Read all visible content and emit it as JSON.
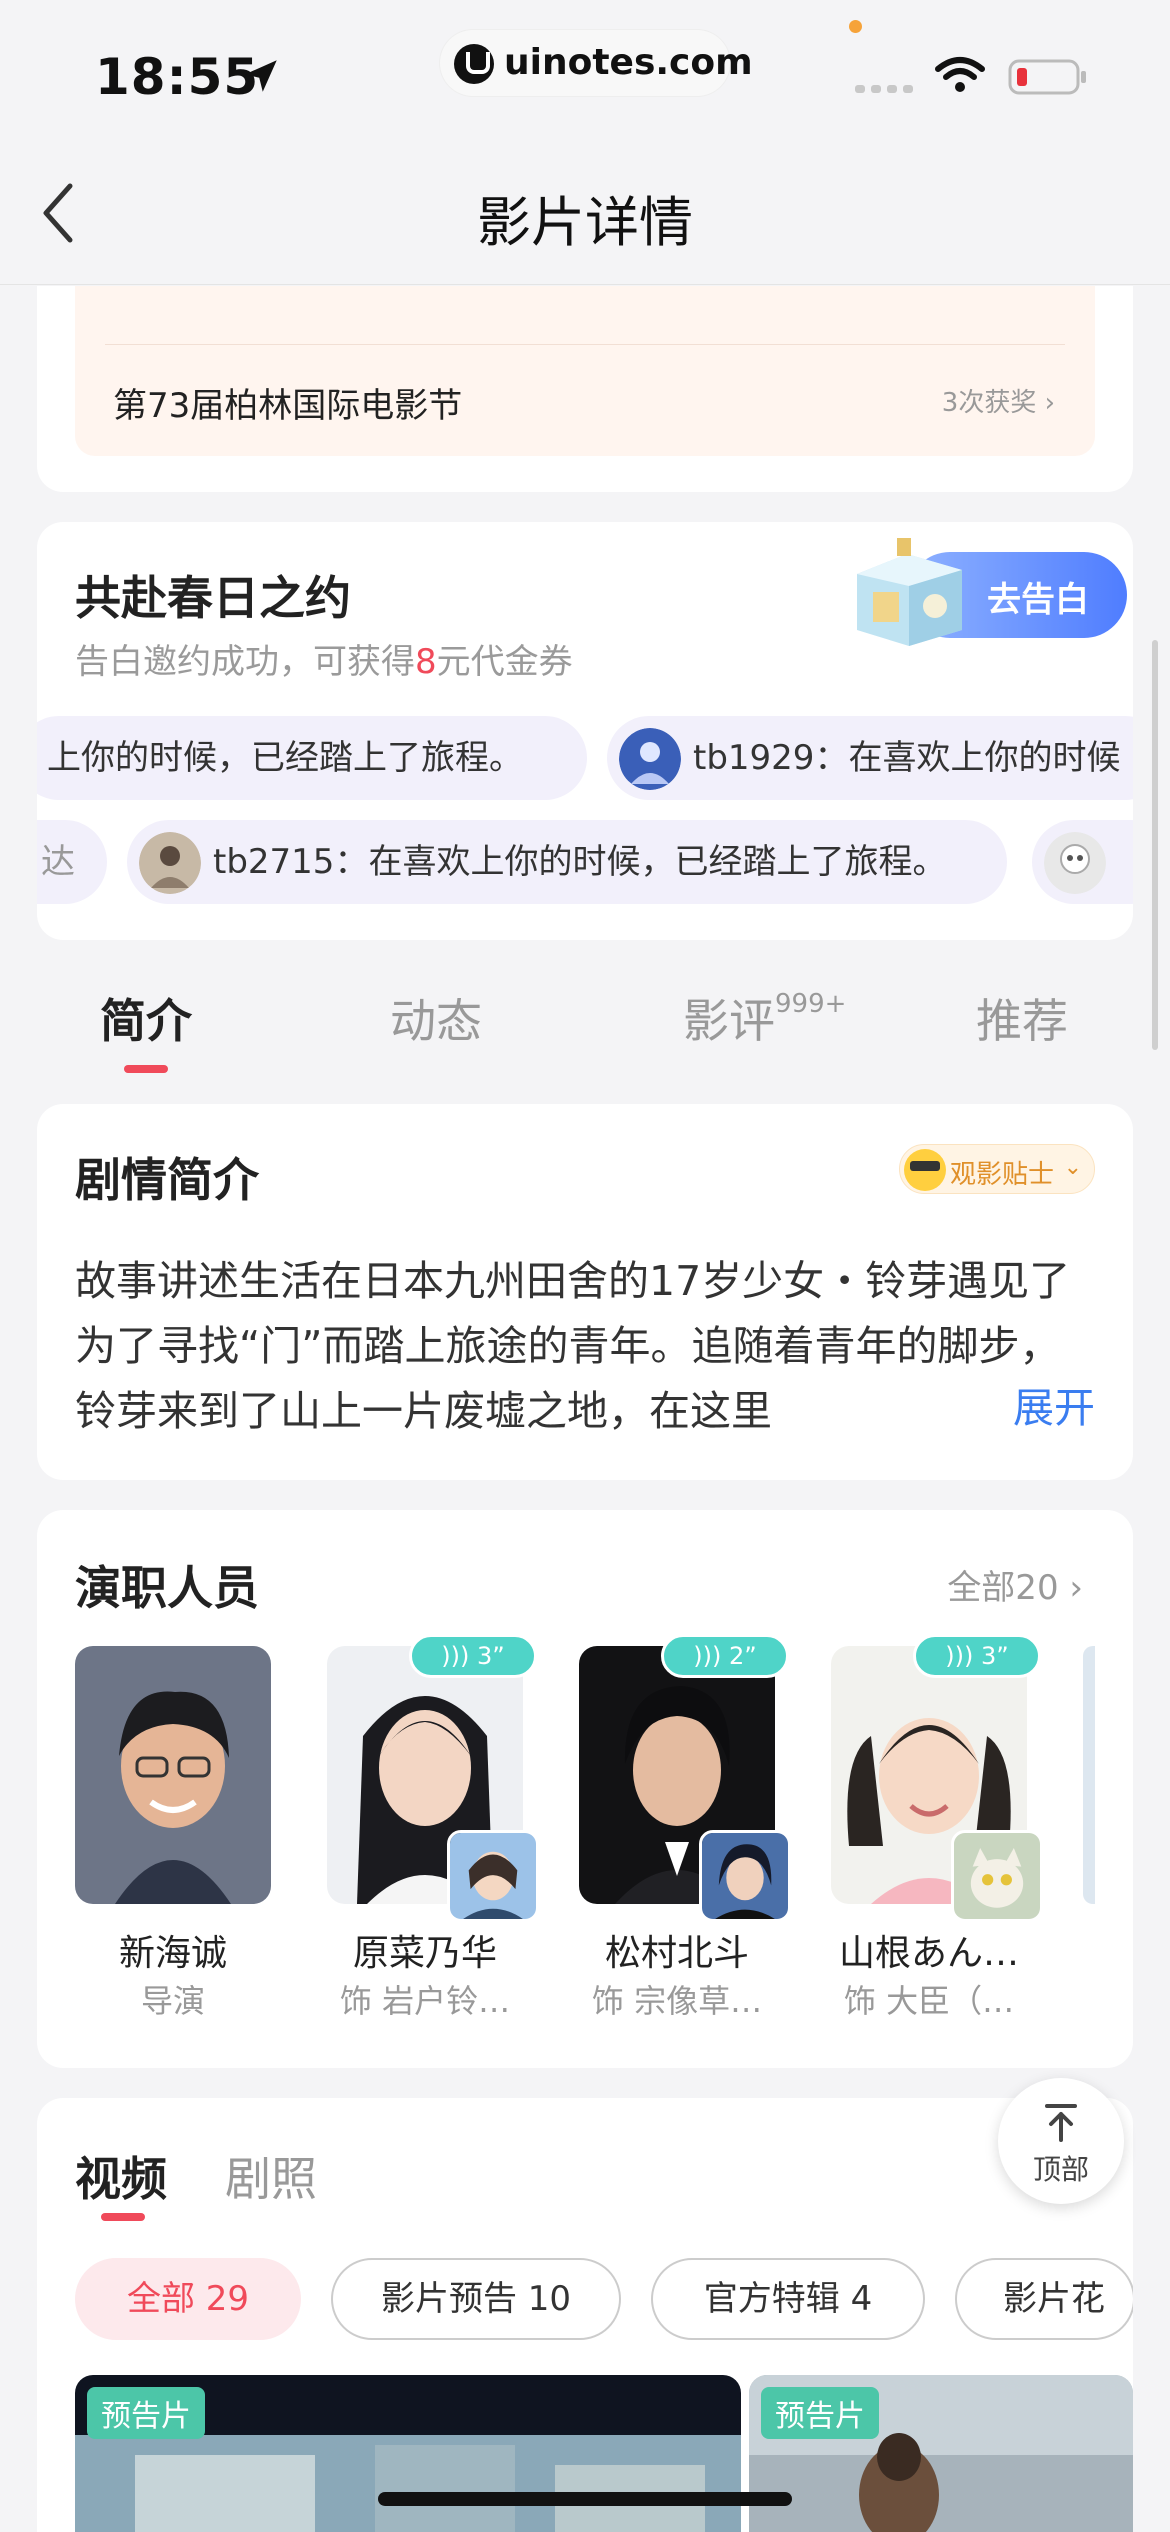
{
  "status_bar": {
    "time": "18:55",
    "url": "uinotes.com"
  },
  "nav": {
    "title": "影片详情"
  },
  "award": {
    "title": "第73届柏林国际电影节",
    "count": "3次获奖 ›"
  },
  "spring": {
    "title": "共赴春日之约",
    "subtitle_pre": "告白邀约成功，可获得",
    "subtitle_highlight": "8",
    "subtitle_post": "元代金券",
    "button": "去告白",
    "danmu_row1": [
      {
        "text": "上你的时候，已经踏上了旅程。"
      },
      {
        "text": "tb1929：在喜欢上你的时候"
      }
    ],
    "danmu_row2": [
      {
        "text": "达"
      },
      {
        "text": "tb2715：在喜欢上你的时候，已经踏上了旅程。"
      }
    ]
  },
  "tabs": [
    {
      "label": "简介"
    },
    {
      "label": "动态"
    },
    {
      "label": "影评",
      "sup": "999+"
    },
    {
      "label": "推荐"
    }
  ],
  "synopsis": {
    "title": "剧情简介",
    "tips": "观影贴士",
    "text": "故事讲述生活在日本九州田舍的17岁少女・铃芽遇见了为了寻找“门”而踏上旅途的青年。追随着青年的脚步，铃芽来到了山上一片废墟之地，在这里",
    "expand": "展开"
  },
  "cast": {
    "title": "演职人员",
    "all": "全部20",
    "members": [
      {
        "name": "新海诚",
        "role": "导演"
      },
      {
        "name": "原菜乃华",
        "role": "饰 岩户铃…",
        "voice": "3”"
      },
      {
        "name": "松村北斗",
        "role": "饰 宗像草…",
        "voice": "2”"
      },
      {
        "name": "山根あん…",
        "role": "饰 大臣（…",
        "voice": "3”"
      }
    ]
  },
  "videos": {
    "tabs": [
      "视频",
      "剧照"
    ],
    "chips": [
      "全部 29",
      "影片预告 10",
      "官方特辑 4",
      "影片花"
    ],
    "thumbs": [
      {
        "tag": "预告片"
      },
      {
        "tag": "预告片"
      }
    ]
  },
  "top_button": {
    "label": "顶部"
  },
  "colors": {
    "accent": "#f04a5a",
    "link": "#3a7df0",
    "voice_badge": "#4fd4c8",
    "tag": "#4cc6a8"
  }
}
